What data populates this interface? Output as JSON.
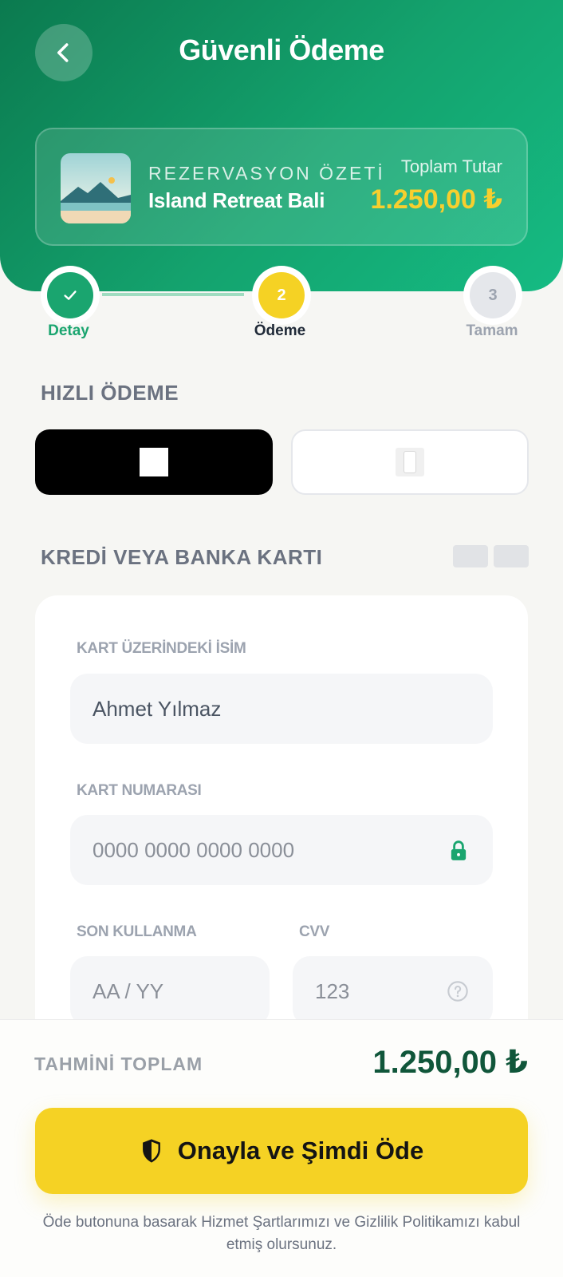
{
  "header": {
    "title": "Güvenli Ödeme",
    "summary_label": "REZERVASYON ÖZETİ",
    "property_name": "Island Retreat Bali",
    "total_label": "Toplam Tutar",
    "total_value": "1.250,00 ₺"
  },
  "steps": [
    {
      "label": "Detay",
      "number": "✓",
      "state": "done"
    },
    {
      "label": "Ödeme",
      "number": "2",
      "state": "active"
    },
    {
      "label": "Tamam",
      "number": "3",
      "state": "pending"
    }
  ],
  "quick_pay": {
    "title": "HIZLI ÖDEME"
  },
  "card": {
    "title": "KREDİ VEYA BANKA KARTI",
    "name_label": "KART ÜZERİNDEKİ İSİM",
    "name_value": "Ahmet Yılmaz",
    "number_label": "KART NUMARASI",
    "number_placeholder": "0000 0000 0000 0000",
    "expiry_label": "SON KULLANMA",
    "expiry_placeholder": "AA / YY",
    "cvv_label": "CVV",
    "cvv_placeholder": "123"
  },
  "footer": {
    "est_label": "TAHMİNİ TOPLAM",
    "est_value": "1.250,00 ₺",
    "confirm_label": "Onayla ve Şimdi Öde",
    "legal": "Öde butonuna basarak Hizmet Şartlarımızı ve Gizlilik Politikamızı kabul etmiş olursunuz."
  },
  "colors": {
    "brand_green": "#0b7a4f",
    "accent_yellow": "#f5d224",
    "step_done": "#1aa56f"
  },
  "icons": {
    "back": "chevron-left-icon",
    "lock": "lock-icon",
    "help": "help-circle-icon",
    "shield": "shield-icon",
    "check": "check-icon"
  }
}
